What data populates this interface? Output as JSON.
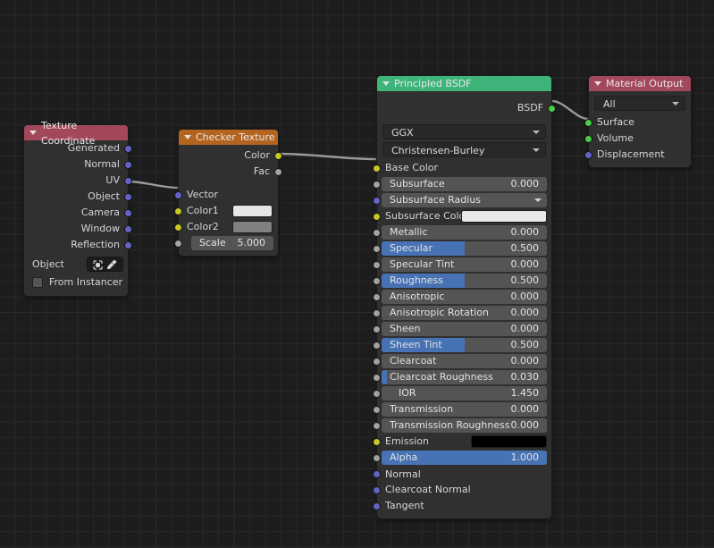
{
  "editor": {
    "background": "#1d1d1d",
    "grid_color": "#262626",
    "grid_major_color": "#2b2b2b"
  },
  "socket_colors": {
    "vector": "#6363c7",
    "color": "#c7c729",
    "value": "#a1a1a1",
    "shader": "#4bc94b"
  },
  "nodes": {
    "texture_coordinate": {
      "title": "Texture Coordinate",
      "header_color": "#a3475a",
      "outputs": [
        {
          "label": "Generated",
          "socket": "vector"
        },
        {
          "label": "Normal",
          "socket": "vector"
        },
        {
          "label": "UV",
          "socket": "vector"
        },
        {
          "label": "Object",
          "socket": "vector"
        },
        {
          "label": "Camera",
          "socket": "vector"
        },
        {
          "label": "Window",
          "socket": "vector"
        },
        {
          "label": "Reflection",
          "socket": "vector"
        }
      ],
      "object_field_label": "Object",
      "object_field_value": "",
      "object_icon": "object-icon",
      "eyedropper_icon": "eyedropper-icon",
      "from_instancer_label": "From Instancer",
      "from_instancer_checked": false
    },
    "checker_texture": {
      "title": "Checker Texture",
      "header_color": "#b4641f",
      "outputs": [
        {
          "label": "Color",
          "socket": "color"
        },
        {
          "label": "Fac",
          "socket": "value"
        }
      ],
      "inputs": [
        {
          "label": "Vector",
          "socket": "vector",
          "type": "label"
        },
        {
          "label": "Color1",
          "socket": "color",
          "type": "swatch",
          "color": "#e6e6e6"
        },
        {
          "label": "Color2",
          "socket": "color",
          "type": "swatch",
          "color": "#808080"
        },
        {
          "label": "Scale",
          "socket": "value",
          "type": "slider",
          "value": "5.000",
          "fill": 0
        }
      ]
    },
    "principled_bsdf": {
      "title": "Principled BSDF",
      "header_color": "#3eb37a",
      "outputs": [
        {
          "label": "BSDF",
          "socket": "shader"
        }
      ],
      "dropdowns": [
        {
          "name": "distribution",
          "value": "GGX"
        },
        {
          "name": "subsurface_method",
          "value": "Christensen-Burley"
        }
      ],
      "inputs": [
        {
          "label": "Base Color",
          "socket": "color",
          "type": "label"
        },
        {
          "label": "Subsurface",
          "socket": "value",
          "type": "slider",
          "value": "0.000",
          "fill": 0
        },
        {
          "label": "Subsurface Radius",
          "socket": "vector",
          "type": "dropdown",
          "value": ""
        },
        {
          "label": "Subsurface Color",
          "socket": "color",
          "type": "swatch",
          "color": "#e8e8e8"
        },
        {
          "label": "Metallic",
          "socket": "value",
          "type": "slider",
          "value": "0.000",
          "fill": 0
        },
        {
          "label": "Specular",
          "socket": "value",
          "type": "slider",
          "value": "0.500",
          "fill": 50
        },
        {
          "label": "Specular Tint",
          "socket": "value",
          "type": "slider",
          "value": "0.000",
          "fill": 0
        },
        {
          "label": "Roughness",
          "socket": "value",
          "type": "slider",
          "value": "0.500",
          "fill": 50
        },
        {
          "label": "Anisotropic",
          "socket": "value",
          "type": "slider",
          "value": "0.000",
          "fill": 0
        },
        {
          "label": "Anisotropic Rotation",
          "socket": "value",
          "type": "slider",
          "value": "0.000",
          "fill": 0
        },
        {
          "label": "Sheen",
          "socket": "value",
          "type": "slider",
          "value": "0.000",
          "fill": 0
        },
        {
          "label": "Sheen Tint",
          "socket": "value",
          "type": "slider",
          "value": "0.500",
          "fill": 50
        },
        {
          "label": "Clearcoat",
          "socket": "value",
          "type": "slider",
          "value": "0.000",
          "fill": 0
        },
        {
          "label": "Clearcoat Roughness",
          "socket": "value",
          "type": "slider",
          "value": "0.030",
          "fill": 3
        },
        {
          "label": "IOR",
          "socket": "value",
          "type": "slider",
          "value": "1.450",
          "fill": 0
        },
        {
          "label": "Transmission",
          "socket": "value",
          "type": "slider",
          "value": "0.000",
          "fill": 0
        },
        {
          "label": "Transmission Roughness",
          "socket": "value",
          "type": "slider",
          "value": "0.000",
          "fill": 0
        },
        {
          "label": "Emission",
          "socket": "color",
          "type": "swatch",
          "color": "#000000"
        },
        {
          "label": "Alpha",
          "socket": "value",
          "type": "slider",
          "value": "1.000",
          "fill": 100
        },
        {
          "label": "Normal",
          "socket": "vector",
          "type": "label"
        },
        {
          "label": "Clearcoat Normal",
          "socket": "vector",
          "type": "label"
        },
        {
          "label": "Tangent",
          "socket": "vector",
          "type": "label"
        }
      ]
    },
    "material_output": {
      "title": "Material Output",
      "header_color": "#a3475a",
      "target_dropdown": "All",
      "inputs": [
        {
          "label": "Surface",
          "socket": "shader"
        },
        {
          "label": "Volume",
          "socket": "shader"
        },
        {
          "label": "Displacement",
          "socket": "vector"
        }
      ]
    }
  },
  "links": [
    {
      "from": "texture_coordinate.UV",
      "to": "checker_texture.Vector"
    },
    {
      "from": "checker_texture.Color",
      "to": "principled_bsdf.Base Color"
    },
    {
      "from": "principled_bsdf.BSDF",
      "to": "material_output.Surface"
    }
  ]
}
